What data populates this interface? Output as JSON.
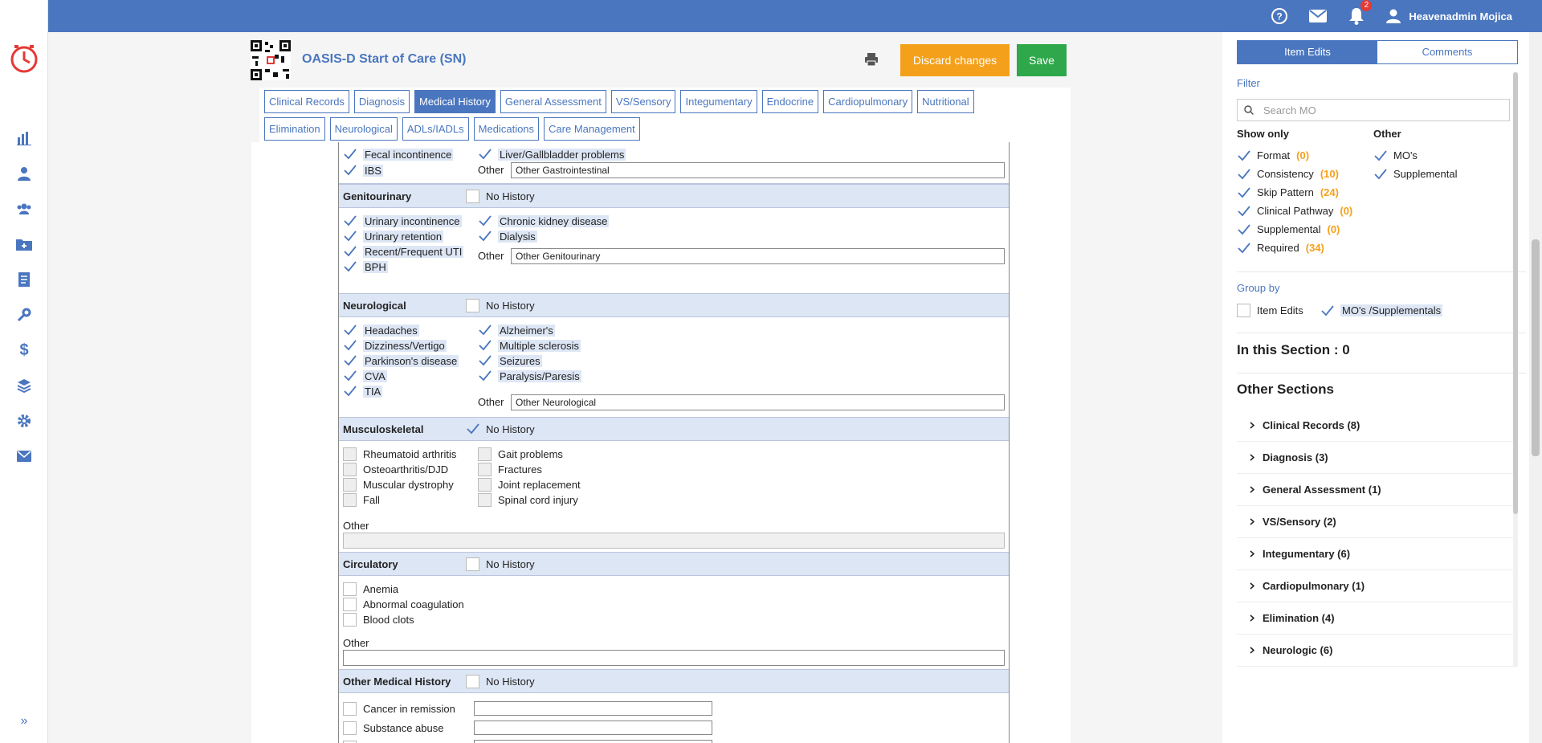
{
  "topbar": {
    "notifications_count": "2",
    "user_name": "Heavenadmin Mojica",
    "icons": [
      "help-icon",
      "mail-icon",
      "bell-icon",
      "user-icon"
    ]
  },
  "sidebar": {
    "nav_icons": [
      "chart-bar-icon",
      "user-nurse-icon",
      "users-icon",
      "folder-plus-icon",
      "document-icon",
      "wrench-icon",
      "dollar-icon",
      "layers-icon",
      "gear-icon",
      "envelope-icon"
    ],
    "expand_label": "»"
  },
  "header": {
    "title": "OASIS-D Start of Care (SN)",
    "discard_label": "Discard changes",
    "save_label": "Save"
  },
  "tabs": {
    "row1": [
      "Clinical Records",
      "Diagnosis",
      "Medical History",
      "General Assessment",
      "VS/Sensory",
      "Integumentary",
      "Endocrine",
      "Cardiopulmonary",
      "Nutritional"
    ],
    "row2": [
      "Elimination",
      "Neurological",
      "ADLs/IADLs",
      "Medications",
      "Care Management"
    ],
    "active": "Medical History"
  },
  "form": {
    "gastro": {
      "fecal": "Fecal incontinence",
      "liver": "Liver/Gallbladder problems",
      "ibs": "IBS",
      "other_label": "Other",
      "other_value": "Other Gastrointestinal"
    },
    "genitourinary": {
      "name": "Genitourinary",
      "no_history": "No History",
      "items_left": [
        "Urinary incontinence",
        "Urinary retention",
        "Recent/Frequent UTI",
        "BPH"
      ],
      "items_right": [
        "Chronic kidney disease",
        "Dialysis"
      ],
      "other_label": "Other",
      "other_value": "Other Genitourinary"
    },
    "neurological": {
      "name": "Neurological",
      "no_history": "No History",
      "items_left": [
        "Headaches",
        "Dizziness/Vertigo",
        "Parkinson's disease",
        "CVA",
        "TIA"
      ],
      "items_right": [
        "Alzheimer's",
        "Multiple sclerosis",
        "Seizures",
        "Paralysis/Paresis"
      ],
      "other_label": "Other",
      "other_value": "Other Neurological"
    },
    "musculoskeletal": {
      "name": "Musculoskeletal",
      "no_history": "No History",
      "items_left": [
        "Rheumatoid arthritis",
        "Osteoarthritis/DJD",
        "Muscular dystrophy",
        "Fall"
      ],
      "items_right": [
        "Gait problems",
        "Fractures",
        "Joint replacement",
        "Spinal cord injury"
      ],
      "other_label": "Other"
    },
    "circulatory": {
      "name": "Circulatory",
      "no_history": "No History",
      "items": [
        "Anemia",
        "Abnormal coagulation",
        "Blood clots"
      ],
      "other_label": "Other"
    },
    "other_medical": {
      "name": "Other Medical History",
      "no_history": "No History",
      "items": [
        "Cancer in remission",
        "Substance abuse"
      ]
    }
  },
  "right_panel": {
    "tab_item_edits": "Item Edits",
    "tab_comments": "Comments",
    "filter_label": "Filter",
    "search_placeholder": "Search MO",
    "show_only_title": "Show only",
    "other_title": "Other",
    "show_only": [
      {
        "label": "Format",
        "count": "(0)"
      },
      {
        "label": "Consistency",
        "count": "(10)"
      },
      {
        "label": "Skip Pattern",
        "count": "(24)"
      },
      {
        "label": "Clinical Pathway",
        "count": "(0)"
      },
      {
        "label": "Supplemental",
        "count": "(0)"
      },
      {
        "label": "Required",
        "count": "(34)"
      }
    ],
    "other": [
      "MO's",
      "Supplemental"
    ],
    "group_by_label": "Group by",
    "group_item_edits": "Item Edits",
    "group_mos": "MO's /Supplementals",
    "in_section": "In this Section : 0",
    "other_sections_title": "Other Sections",
    "other_sections": [
      "Clinical Records (8)",
      "Diagnosis (3)",
      "General Assessment (1)",
      "VS/Sensory (2)",
      "Integumentary (6)",
      "Cardiopulmonary (1)",
      "Elimination (4)",
      "Neurologic (6)"
    ],
    "colors": {
      "accent": "#4a76bf",
      "count": "#f5a01a",
      "discard": "#f5a01a",
      "save": "#2ea84a"
    }
  }
}
